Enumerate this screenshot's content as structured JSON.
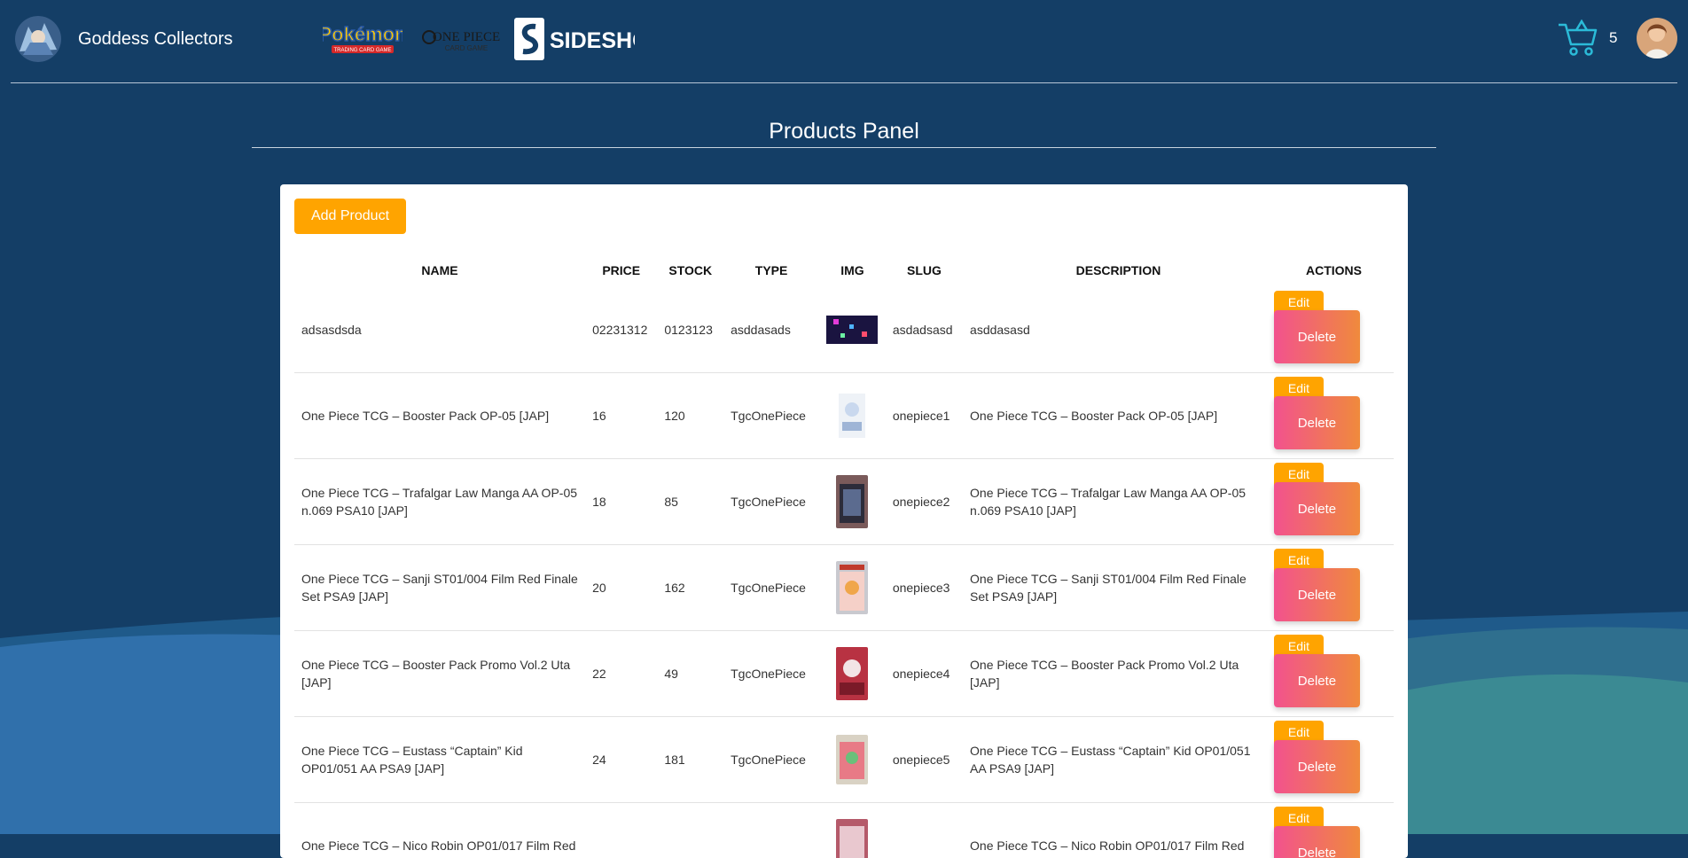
{
  "header": {
    "brand_name": "Goddess Collectors",
    "partners": [
      "pokemon-logo",
      "one-piece-card-game-logo",
      "sideshow-logo"
    ],
    "sideshow_label": "SIDESHOW",
    "pokemon_label": "Pokémon",
    "pokemon_sub": "TRADING CARD GAME",
    "onepiece_label": "ONE PIECE",
    "onepiece_sub": "CARD GAME",
    "cart_count": "5"
  },
  "page": {
    "title": "Products Panel",
    "add_button": "Add Product"
  },
  "table": {
    "headers": [
      "NAME",
      "PRICE",
      "STOCK",
      "TYPE",
      "IMG",
      "SLUG",
      "DESCRIPTION",
      "ACTIONS"
    ],
    "edit_label": "Edit",
    "delete_label": "Delete",
    "rows": [
      {
        "name": "adsasdsda",
        "price": "02231312",
        "stock": "0123123",
        "type": "asddasads",
        "slug": "asdadsasd",
        "description": "asddasasd"
      },
      {
        "name": "One Piece TCG – Booster Pack OP-05 [JAP]",
        "price": "16",
        "stock": "120",
        "type": "TgcOnePiece",
        "slug": "onepiece1",
        "description": "One Piece TCG – Booster Pack OP-05 [JAP]"
      },
      {
        "name": "One Piece TCG – Trafalgar Law Manga AA OP-05 n.069 PSA10 [JAP]",
        "price": "18",
        "stock": "85",
        "type": "TgcOnePiece",
        "slug": "onepiece2",
        "description": "One Piece TCG – Trafalgar Law Manga AA OP-05 n.069 PSA10 [JAP]"
      },
      {
        "name": "One Piece TCG – Sanji ST01/004 Film Red Finale Set PSA9 [JAP]",
        "price": "20",
        "stock": "162",
        "type": "TgcOnePiece",
        "slug": "onepiece3",
        "description": "One Piece TCG – Sanji ST01/004 Film Red Finale Set PSA9 [JAP]"
      },
      {
        "name": "One Piece TCG – Booster Pack Promo Vol.2 Uta [JAP]",
        "price": "22",
        "stock": "49",
        "type": "TgcOnePiece",
        "slug": "onepiece4",
        "description": "One Piece TCG – Booster Pack Promo Vol.2 Uta [JAP]"
      },
      {
        "name": "One Piece TCG – Eustass “Captain” Kid OP01/051 AA PSA9 [JAP]",
        "price": "24",
        "stock": "181",
        "type": "TgcOnePiece",
        "slug": "onepiece5",
        "description": "One Piece TCG – Eustass “Captain” Kid OP01/051 AA PSA9 [JAP]"
      },
      {
        "name": "One Piece TCG – Nico Robin OP01/017 Film Red",
        "price": "",
        "stock": "",
        "type": "",
        "slug": "",
        "description": "One Piece TCG – Nico Robin OP01/017 Film Red"
      }
    ]
  },
  "colors": {
    "background": "#143e66",
    "accent": "#ffa400",
    "delete_start": "#f2528e",
    "delete_end": "#f08a3c"
  }
}
